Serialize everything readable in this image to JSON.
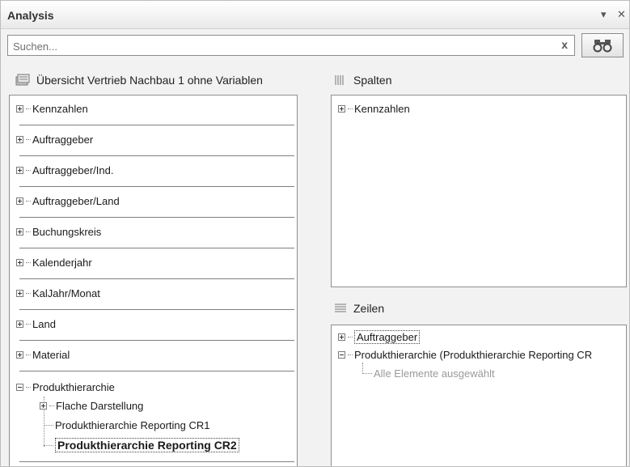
{
  "panel": {
    "title": "Analysis",
    "dropdown_icon": "▾",
    "close_icon": "✕"
  },
  "search": {
    "placeholder": "Suchen...",
    "clear_icon": "x",
    "find_icon": "binoculars-icon"
  },
  "query": {
    "title": "Übersicht Vertrieb Nachbau 1 ohne Variablen",
    "icon": "query-icon"
  },
  "fields": [
    {
      "label": "Kennzahlen",
      "state": "collapsed"
    },
    {
      "label": "Auftraggeber",
      "state": "collapsed"
    },
    {
      "label": "Auftraggeber/Ind.",
      "state": "collapsed"
    },
    {
      "label": "Auftraggeber/Land",
      "state": "collapsed"
    },
    {
      "label": "Buchungskreis",
      "state": "collapsed"
    },
    {
      "label": "Kalenderjahr",
      "state": "collapsed"
    },
    {
      "label": "KalJahr/Monat",
      "state": "collapsed"
    },
    {
      "label": "Land",
      "state": "collapsed"
    },
    {
      "label": "Material",
      "state": "collapsed"
    },
    {
      "label": "Produkthierarchie",
      "state": "expanded"
    }
  ],
  "hierarchy_children": [
    {
      "label": "Flache Darstellung",
      "state": "collapsed"
    },
    {
      "label": "Produkthierarchie Reporting CR1",
      "state": "leaf"
    },
    {
      "label": "Produkthierarchie Reporting CR2",
      "state": "leaf-selected"
    }
  ],
  "columns": {
    "title": "Spalten",
    "icon": "columns-icon",
    "items": [
      {
        "label": "Kennzahlen",
        "state": "collapsed"
      }
    ]
  },
  "rows": {
    "title": "Zeilen",
    "icon": "rows-icon",
    "items": [
      {
        "label": "Auftraggeber",
        "state": "collapsed"
      },
      {
        "label": "Produkthierarchie (Produkthierarchie Reporting CR",
        "state": "expanded"
      }
    ],
    "sub_item": "Alle Elemente ausgewählt"
  }
}
